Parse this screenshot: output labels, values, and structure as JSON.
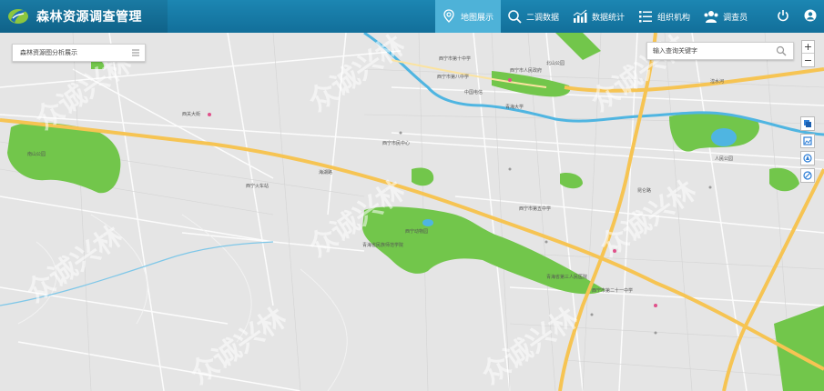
{
  "app": {
    "title": "森林资源调查管理"
  },
  "nav": {
    "items": [
      {
        "label": "地图展示",
        "icon": "map-pin-icon"
      },
      {
        "label": "二调数据",
        "icon": "search-icon"
      },
      {
        "label": "数据统计",
        "icon": "chart-icon"
      },
      {
        "label": "组织机构",
        "icon": "list-icon"
      },
      {
        "label": "调查员",
        "icon": "users-icon"
      }
    ],
    "active": "地图展示"
  },
  "panel": {
    "label": "森林资源图分析展示"
  },
  "search": {
    "placeholder": "输入查询关键字"
  },
  "zoom": {
    "in": "+",
    "out": "−"
  },
  "map_labels": [
    "西宁市第十中学",
    "西宁市人民政府",
    "西宁市第八中学",
    "中国电信",
    "青海大学",
    "人民公园",
    "西宁市民中心",
    "青海省第三人民医院",
    "西宁市第五中学",
    "西宁动物园",
    "青海省民族师范学院",
    "南山公园",
    "西宁市第二十一中学",
    "湟水河",
    "西关大街",
    "昆仑路",
    "海湖路",
    "北山公园",
    "西宁火车站"
  ],
  "watermark": "众诚兴林",
  "colors": {
    "topbar": "#1a7aa3",
    "nav_active": "#4eb2d8",
    "park_green": "#72c64b",
    "water": "#4fb5e1",
    "road_yellow": "#f6c453"
  }
}
